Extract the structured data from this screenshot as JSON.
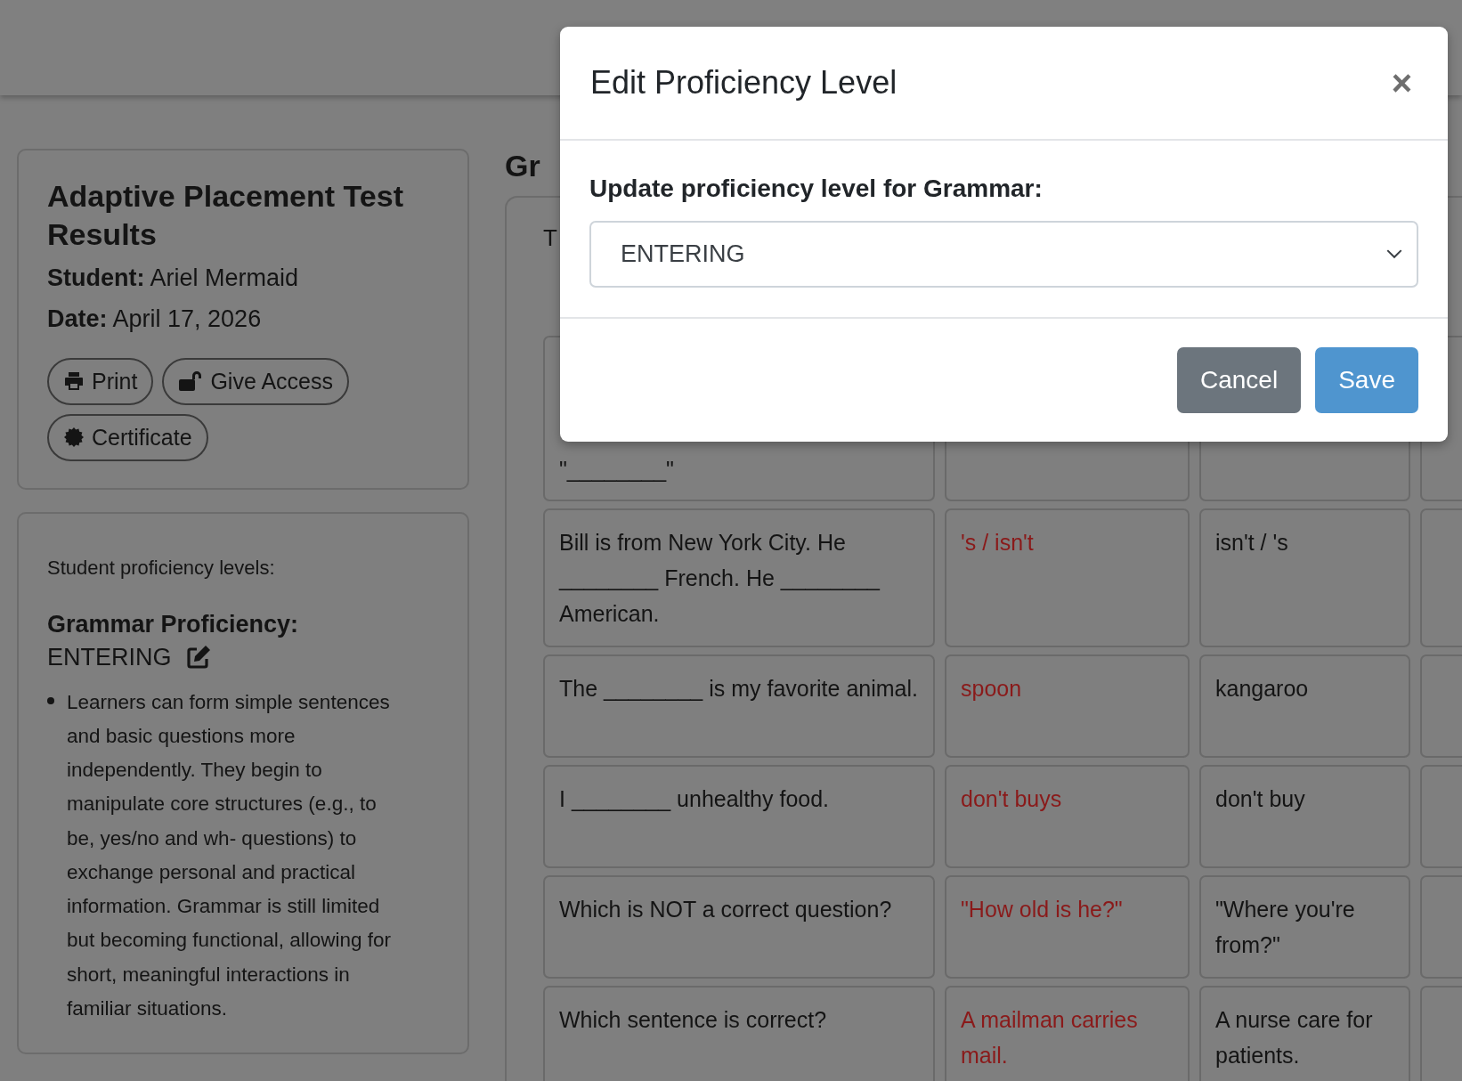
{
  "results_card": {
    "title": "Adaptive Placement Test Results",
    "student": "**Student:** Ariel Mermaid",
    "date": "**Date:** April 17, 2026",
    "buttons": [
      {
        "kind": "print",
        "label": "Print"
      },
      {
        "kind": "unlock",
        "label": "Give Access"
      },
      {
        "kind": "badge",
        "label": "Certificate"
      }
    ]
  },
  "proficiency_card": {
    "intro": "Student proficiency levels:",
    "heading": "Grammar Proficiency:",
    "level": "ENTERING",
    "description": "Learners can form simple sentences and basic questions more independently. They begin to manipulate core structures (e.g., to be, yes/no and wh- questions) to exchange personal and practical information. Grammar is still limited but becoming functional, allowing for short, meaningful interactions in familiar situations."
  },
  "section": {
    "heading": "Gr",
    "table_header": "T",
    "rows": [
      {
        "question": "\"________\""
      },
      {
        "question": "Bill is from New York City. He ________ French. He ________ American.",
        "answer": "'s / isn't",
        "answer_correct": false,
        "correct_answer": "isn't / 's"
      },
      {
        "question": "The ________ is my favorite animal.",
        "answer": "spoon",
        "answer_correct": false,
        "correct_answer": "kangaroo"
      },
      {
        "question": "I ________ unhealthy food.",
        "answer": "don't buys",
        "answer_correct": false,
        "correct_answer": "don't buy"
      },
      {
        "question": "Which is NOT a correct question?",
        "answer": "\"How old is he?\"",
        "answer_correct": false,
        "correct_answer": "\"Where you're from?\""
      },
      {
        "question": "Which sentence is correct?",
        "answer": "A mailman carries mail.",
        "answer_correct": false,
        "correct_answer": "A nurse care for patients."
      }
    ]
  },
  "modal": {
    "title": "Edit Proficiency Level",
    "close": "×",
    "label": "Update proficiency level for Grammar:",
    "select_value": "ENTERING",
    "buttons": [
      {
        "kind": "secondary",
        "label": "Cancel"
      },
      {
        "kind": "primary",
        "label": "Save"
      }
    ]
  }
}
